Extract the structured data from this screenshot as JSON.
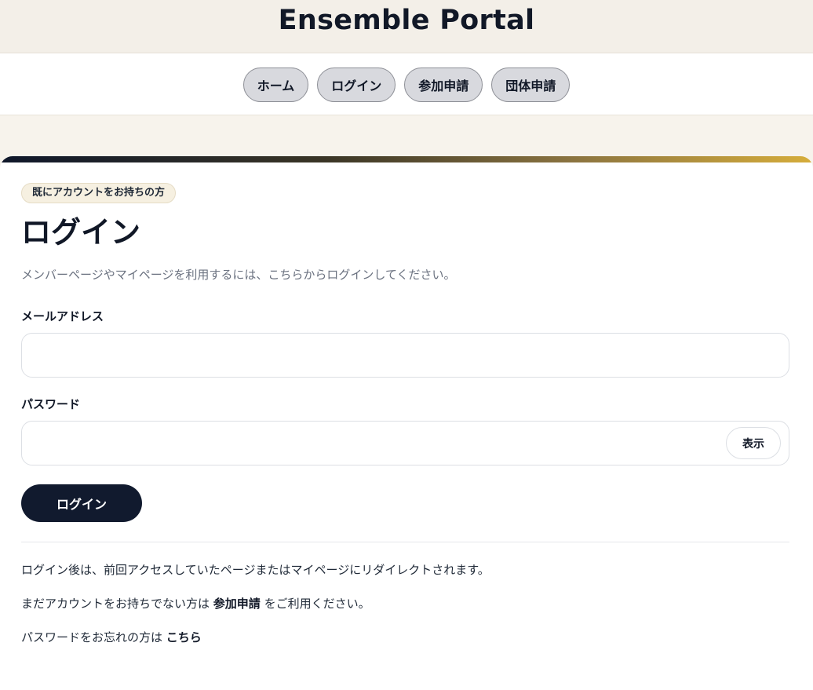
{
  "header": {
    "title": "Ensemble Portal"
  },
  "nav": {
    "items": [
      {
        "label": "ホーム"
      },
      {
        "label": "ログイン"
      },
      {
        "label": "参加申請"
      },
      {
        "label": "団体申請"
      }
    ]
  },
  "card": {
    "gradient_colors": [
      "#0f172a",
      "#d6ad3b"
    ],
    "eyebrow": "既にアカウントをお持ちの方",
    "title": "ログイン",
    "description": "メンバーページやマイページを利用するには、こちらからログインしてください。",
    "email": {
      "label": "メールアドレス",
      "value": "",
      "placeholder": ""
    },
    "password": {
      "label": "パスワード",
      "value": "",
      "placeholder": "",
      "toggle_label": "表示"
    },
    "submit_label": "ログイン",
    "notes": {
      "redirect": "ログイン後は、前回アクセスしていたページまたはマイページにリダイレクトされます。",
      "signup_prefix": "まだアカウントをお持ちでない方は ",
      "signup_link": "参加申請",
      "signup_suffix": " をご利用ください。",
      "forgot_prefix": "パスワードをお忘れの方は ",
      "forgot_link": "こちら"
    }
  }
}
